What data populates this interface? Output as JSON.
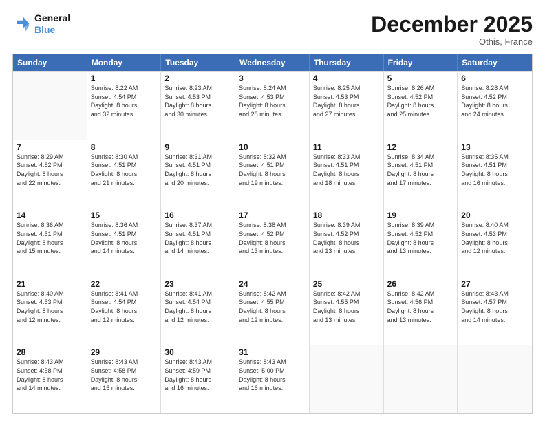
{
  "header": {
    "logo_line1": "General",
    "logo_line2": "Blue",
    "month": "December 2025",
    "location": "Othis, France"
  },
  "days": [
    "Sunday",
    "Monday",
    "Tuesday",
    "Wednesday",
    "Thursday",
    "Friday",
    "Saturday"
  ],
  "rows": [
    [
      {
        "date": "",
        "info": ""
      },
      {
        "date": "1",
        "info": "Sunrise: 8:22 AM\nSunset: 4:54 PM\nDaylight: 8 hours\nand 32 minutes."
      },
      {
        "date": "2",
        "info": "Sunrise: 8:23 AM\nSunset: 4:53 PM\nDaylight: 8 hours\nand 30 minutes."
      },
      {
        "date": "3",
        "info": "Sunrise: 8:24 AM\nSunset: 4:53 PM\nDaylight: 8 hours\nand 28 minutes."
      },
      {
        "date": "4",
        "info": "Sunrise: 8:25 AM\nSunset: 4:53 PM\nDaylight: 8 hours\nand 27 minutes."
      },
      {
        "date": "5",
        "info": "Sunrise: 8:26 AM\nSunset: 4:52 PM\nDaylight: 8 hours\nand 25 minutes."
      },
      {
        "date": "6",
        "info": "Sunrise: 8:28 AM\nSunset: 4:52 PM\nDaylight: 8 hours\nand 24 minutes."
      }
    ],
    [
      {
        "date": "7",
        "info": "Sunrise: 8:29 AM\nSunset: 4:52 PM\nDaylight: 8 hours\nand 22 minutes."
      },
      {
        "date": "8",
        "info": "Sunrise: 8:30 AM\nSunset: 4:51 PM\nDaylight: 8 hours\nand 21 minutes."
      },
      {
        "date": "9",
        "info": "Sunrise: 8:31 AM\nSunset: 4:51 PM\nDaylight: 8 hours\nand 20 minutes."
      },
      {
        "date": "10",
        "info": "Sunrise: 8:32 AM\nSunset: 4:51 PM\nDaylight: 8 hours\nand 19 minutes."
      },
      {
        "date": "11",
        "info": "Sunrise: 8:33 AM\nSunset: 4:51 PM\nDaylight: 8 hours\nand 18 minutes."
      },
      {
        "date": "12",
        "info": "Sunrise: 8:34 AM\nSunset: 4:51 PM\nDaylight: 8 hours\nand 17 minutes."
      },
      {
        "date": "13",
        "info": "Sunrise: 8:35 AM\nSunset: 4:51 PM\nDaylight: 8 hours\nand 16 minutes."
      }
    ],
    [
      {
        "date": "14",
        "info": "Sunrise: 8:36 AM\nSunset: 4:51 PM\nDaylight: 8 hours\nand 15 minutes."
      },
      {
        "date": "15",
        "info": "Sunrise: 8:36 AM\nSunset: 4:51 PM\nDaylight: 8 hours\nand 14 minutes."
      },
      {
        "date": "16",
        "info": "Sunrise: 8:37 AM\nSunset: 4:51 PM\nDaylight: 8 hours\nand 14 minutes."
      },
      {
        "date": "17",
        "info": "Sunrise: 8:38 AM\nSunset: 4:52 PM\nDaylight: 8 hours\nand 13 minutes."
      },
      {
        "date": "18",
        "info": "Sunrise: 8:39 AM\nSunset: 4:52 PM\nDaylight: 8 hours\nand 13 minutes."
      },
      {
        "date": "19",
        "info": "Sunrise: 8:39 AM\nSunset: 4:52 PM\nDaylight: 8 hours\nand 13 minutes."
      },
      {
        "date": "20",
        "info": "Sunrise: 8:40 AM\nSunset: 4:53 PM\nDaylight: 8 hours\nand 12 minutes."
      }
    ],
    [
      {
        "date": "21",
        "info": "Sunrise: 8:40 AM\nSunset: 4:53 PM\nDaylight: 8 hours\nand 12 minutes."
      },
      {
        "date": "22",
        "info": "Sunrise: 8:41 AM\nSunset: 4:54 PM\nDaylight: 8 hours\nand 12 minutes."
      },
      {
        "date": "23",
        "info": "Sunrise: 8:41 AM\nSunset: 4:54 PM\nDaylight: 8 hours\nand 12 minutes."
      },
      {
        "date": "24",
        "info": "Sunrise: 8:42 AM\nSunset: 4:55 PM\nDaylight: 8 hours\nand 12 minutes."
      },
      {
        "date": "25",
        "info": "Sunrise: 8:42 AM\nSunset: 4:55 PM\nDaylight: 8 hours\nand 13 minutes."
      },
      {
        "date": "26",
        "info": "Sunrise: 8:42 AM\nSunset: 4:56 PM\nDaylight: 8 hours\nand 13 minutes."
      },
      {
        "date": "27",
        "info": "Sunrise: 8:43 AM\nSunset: 4:57 PM\nDaylight: 8 hours\nand 14 minutes."
      }
    ],
    [
      {
        "date": "28",
        "info": "Sunrise: 8:43 AM\nSunset: 4:58 PM\nDaylight: 8 hours\nand 14 minutes."
      },
      {
        "date": "29",
        "info": "Sunrise: 8:43 AM\nSunset: 4:58 PM\nDaylight: 8 hours\nand 15 minutes."
      },
      {
        "date": "30",
        "info": "Sunrise: 8:43 AM\nSunset: 4:59 PM\nDaylight: 8 hours\nand 16 minutes."
      },
      {
        "date": "31",
        "info": "Sunrise: 8:43 AM\nSunset: 5:00 PM\nDaylight: 8 hours\nand 16 minutes."
      },
      {
        "date": "",
        "info": ""
      },
      {
        "date": "",
        "info": ""
      },
      {
        "date": "",
        "info": ""
      }
    ]
  ]
}
